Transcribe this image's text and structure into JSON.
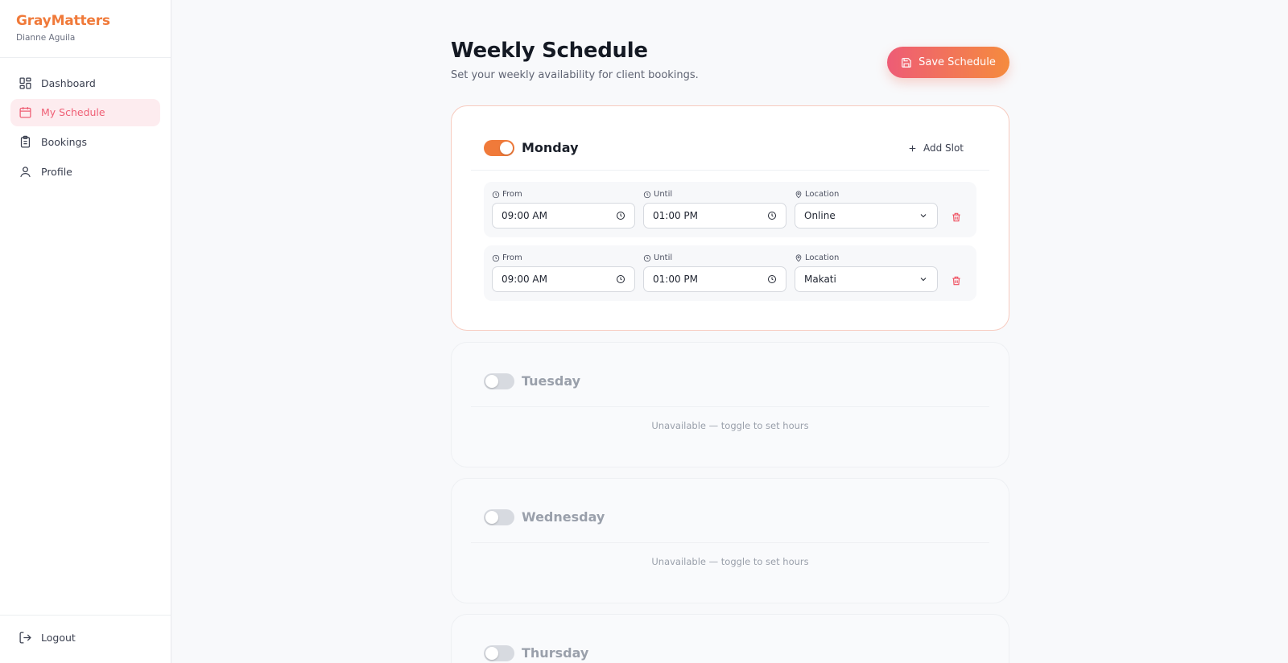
{
  "app": {
    "brand": "GrayMatters",
    "user": "Dianne Aguila"
  },
  "sidebar": {
    "items": [
      {
        "label": "Dashboard",
        "icon": "dashboard-icon"
      },
      {
        "label": "My Schedule",
        "icon": "calendar-icon",
        "active": true
      },
      {
        "label": "Bookings",
        "icon": "clipboard-icon"
      },
      {
        "label": "Profile",
        "icon": "user-icon"
      }
    ],
    "logout": {
      "label": "Logout",
      "icon": "logout-icon"
    }
  },
  "header": {
    "title": "Weekly Schedule",
    "subtitle": "Set your weekly availability for client bookings.",
    "save_label": "Save Schedule"
  },
  "days": [
    {
      "name": "Monday",
      "enabled": true,
      "add_slot_label": "Add Slot",
      "slots": [
        {
          "from_label": "From",
          "from": "09:00 AM",
          "until_label": "Until",
          "until": "01:00 PM",
          "location_label": "Location",
          "location": "Online"
        },
        {
          "from_label": "From",
          "from": "09:00 AM",
          "until_label": "Until",
          "until": "01:00 PM",
          "location_label": "Location",
          "location": "Makati"
        }
      ]
    },
    {
      "name": "Tuesday",
      "enabled": false,
      "unavailable_text": "Unavailable — toggle to set hours"
    },
    {
      "name": "Wednesday",
      "enabled": false,
      "unavailable_text": "Unavailable — toggle to set hours"
    },
    {
      "name": "Thursday",
      "enabled": false
    }
  ],
  "colors": {
    "brand": "#f07a3a",
    "accent": "#ef5f75",
    "danger": "#ef4f5f"
  }
}
